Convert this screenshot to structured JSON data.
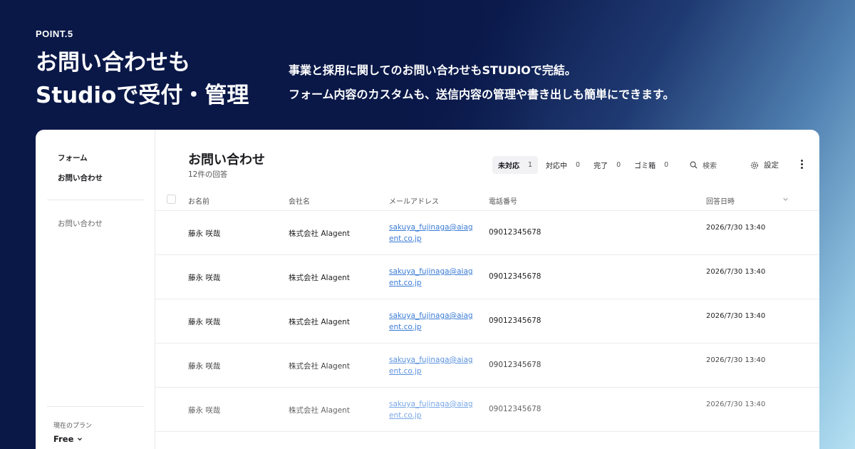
{
  "hero": {
    "point": "POINT.5",
    "title_line1": "お問い合わせも",
    "title_line2": "Studioで受付・管理",
    "desc_line1": "事業と採用に関してのお問い合わせもSTUDIOで完結。",
    "desc_line2": "フォーム内容のカスタムも、送信内容の管理や書き出しも簡単にできます。"
  },
  "sidebar": {
    "forms_label": "フォーム",
    "contact_label": "お問い合わせ",
    "sub_item": "お問い合わせ",
    "plan_label": "現在のプラン",
    "plan_value": "Free"
  },
  "main": {
    "title": "お問い合わせ",
    "count": "12件の回答",
    "filters": [
      {
        "label": "未対応",
        "count": "1"
      },
      {
        "label": "対応中",
        "count": "0"
      },
      {
        "label": "完了",
        "count": "0"
      },
      {
        "label": "ゴミ箱",
        "count": "0"
      }
    ],
    "search_label": "検索",
    "settings_label": "設定"
  },
  "table": {
    "headers": {
      "name": "お名前",
      "company": "会社名",
      "email": "メールアドレス",
      "phone": "電話番号",
      "date": "回答日時"
    },
    "rows": [
      {
        "name": "藤永 咲哉",
        "company": "株式会社 AIagent",
        "email": "sakuya_fujinaga@aiagent.co.jp",
        "phone": "09012345678",
        "date": "2026/7/30 13:40"
      },
      {
        "name": "藤永 咲哉",
        "company": "株式会社 AIagent",
        "email": "sakuya_fujinaga@aiagent.co.jp",
        "phone": "09012345678",
        "date": "2026/7/30 13:40"
      },
      {
        "name": "藤永 咲哉",
        "company": "株式会社 AIagent",
        "email": "sakuya_fujinaga@aiagent.co.jp",
        "phone": "09012345678",
        "date": "2026/7/30 13:40"
      },
      {
        "name": "藤永 咲哉",
        "company": "株式会社 AIagent",
        "email": "sakuya_fujinaga@aiagent.co.jp",
        "phone": "09012345678",
        "date": "2026/7/30 13:40"
      },
      {
        "name": "藤永 咲哉",
        "company": "株式会社 AIagent",
        "email": "sakuya_fujinaga@aiagent.co.jp",
        "phone": "09012345678",
        "date": "2026/7/30 13:40"
      }
    ]
  },
  "colors": {
    "background_dark": "#0a1848",
    "background_light": "#b6e0f2",
    "link": "#3a7bd5",
    "card": "#ffffff"
  }
}
